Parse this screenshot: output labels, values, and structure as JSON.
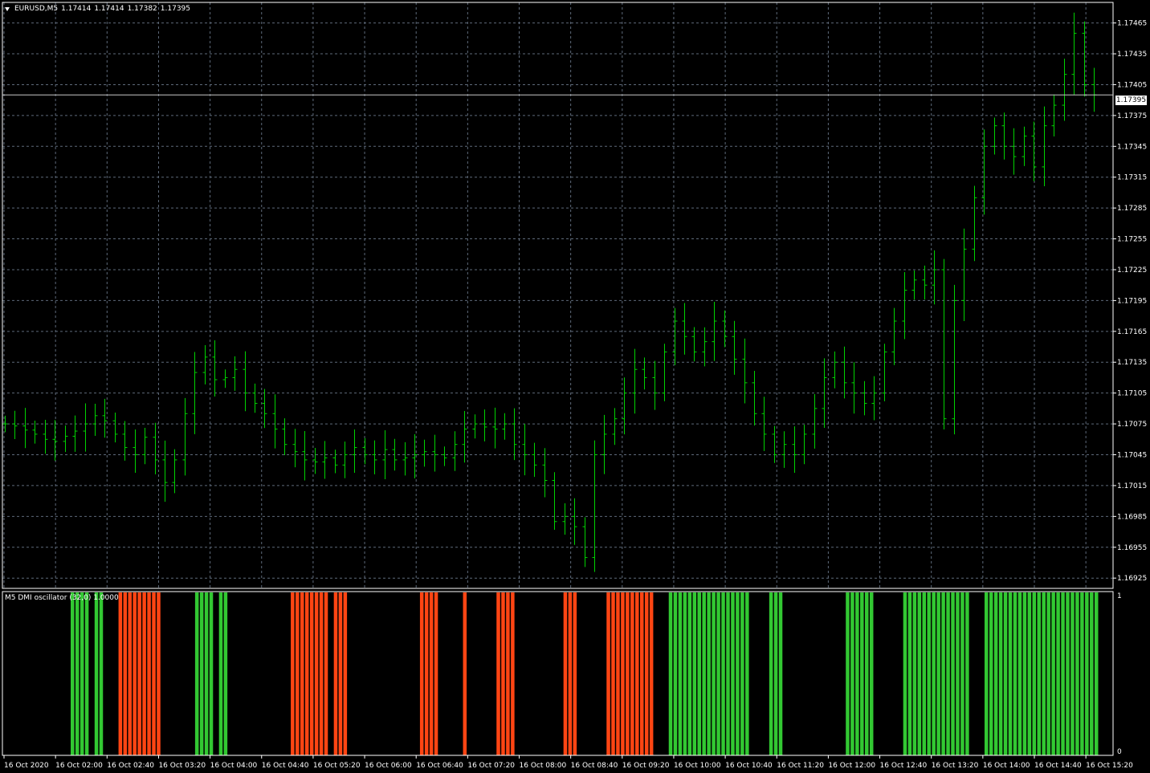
{
  "header": {
    "symbol": "EURUSD,M5",
    "open": "1.17414",
    "high": "1.17414",
    "low": "1.17382",
    "close": "1.17395"
  },
  "current_price": "1.17395",
  "indicator": {
    "label": "M5 DMI oscillator (32,0) 1.0000"
  },
  "colors": {
    "background": "#000000",
    "grid": "#5e6a7a",
    "bar": "#00d200",
    "bull": "#32c832",
    "bear": "#ff4513",
    "axis": "#ffffff"
  },
  "chart_data": [
    {
      "type": "ohlc",
      "title": "",
      "ylim": [
        1.16915,
        1.17485
      ],
      "y_ticks": [
        "1.16925",
        "1.16955",
        "1.16985",
        "1.17015",
        "1.17045",
        "1.17075",
        "1.17105",
        "1.17135",
        "1.17165",
        "1.17195",
        "1.17225",
        "1.17255",
        "1.17285",
        "1.17315",
        "1.17345",
        "1.17375",
        "1.17405",
        "1.17435",
        "1.17465"
      ],
      "x_ticks": [
        "16 Oct 2020",
        "16 Oct 02:00",
        "16 Oct 02:40",
        "16 Oct 03:20",
        "16 Oct 04:00",
        "16 Oct 04:40",
        "16 Oct 05:20",
        "16 Oct 06:00",
        "16 Oct 06:40",
        "16 Oct 07:20",
        "16 Oct 08:00",
        "16 Oct 08:40",
        "16 Oct 09:20",
        "16 Oct 10:00",
        "16 Oct 10:40",
        "16 Oct 11:20",
        "16 Oct 12:00",
        "16 Oct 12:40",
        "16 Oct 13:20",
        "16 Oct 14:00",
        "16 Oct 14:40",
        "16 Oct 15:20"
      ],
      "close_path": [
        1.17075,
        1.17073,
        1.17069,
        1.17065,
        1.1706,
        1.17058,
        1.17063,
        1.17068,
        1.17075,
        1.17083,
        1.17078,
        1.17065,
        1.17052,
        1.17045,
        1.17062,
        1.1704,
        1.17018,
        1.1704,
        1.17085,
        1.17125,
        1.1714,
        1.17118,
        1.1712,
        1.17128,
        1.17105,
        1.17095,
        1.17085,
        1.1707,
        1.17055,
        1.17048,
        1.1704,
        1.17038,
        1.17042,
        1.17035,
        1.17045,
        1.17052,
        1.17045,
        1.1704,
        1.1705,
        1.1704,
        1.17042,
        1.17045,
        1.17048,
        1.17045,
        1.17042,
        1.17055,
        1.1707,
        1.17075,
        1.17072,
        1.1707,
        1.17075,
        1.17055,
        1.17045,
        1.17035,
        1.1702,
        1.1698,
        1.16985,
        1.16975,
        1.16945,
        1.17045,
        1.17065,
        1.1708,
        1.17105,
        1.17128,
        1.1712,
        1.17105,
        1.17145,
        1.17175,
        1.1716,
        1.17145,
        1.17155,
        1.17175,
        1.1716,
        1.17138,
        1.17115,
        1.17085,
        1.17065,
        1.17045,
        1.17055,
        1.17045,
        1.17065,
        1.1709,
        1.1712,
        1.17135,
        1.17115,
        1.17105,
        1.17095,
        1.17105,
        1.17145,
        1.17175,
        1.17205,
        1.17215,
        1.1721,
        1.17225,
        1.1708,
        1.17195,
        1.17245,
        1.17295,
        1.17345,
        1.17365,
        1.17345,
        1.17335,
        1.17355,
        1.17325,
        1.17365,
        1.17385,
        1.17415,
        1.17455,
        1.17405,
        1.17395
      ]
    },
    {
      "type": "histogram",
      "title": "M5 DMI oscillator (32,0) 1.0000",
      "ylim": [
        0,
        1
      ],
      "y_ticks": [
        "1",
        "0"
      ],
      "groups": [
        {
          "sign": 1,
          "count": 4
        },
        {
          "sign": 0,
          "count": 1
        },
        {
          "sign": 1,
          "count": 2
        },
        {
          "sign": 0,
          "count": 3
        },
        {
          "sign": -1,
          "count": 9
        },
        {
          "sign": 0,
          "count": 7
        },
        {
          "sign": 1,
          "count": 4
        },
        {
          "sign": 0,
          "count": 1
        },
        {
          "sign": 1,
          "count": 2
        },
        {
          "sign": 0,
          "count": 13
        },
        {
          "sign": -1,
          "count": 8
        },
        {
          "sign": 0,
          "count": 1
        },
        {
          "sign": -1,
          "count": 3
        },
        {
          "sign": 0,
          "count": 15
        },
        {
          "sign": -1,
          "count": 4
        },
        {
          "sign": 0,
          "count": 5
        },
        {
          "sign": -1,
          "count": 1
        },
        {
          "sign": 0,
          "count": 6
        },
        {
          "sign": -1,
          "count": 4
        },
        {
          "sign": 0,
          "count": 10
        },
        {
          "sign": -1,
          "count": 3
        },
        {
          "sign": 0,
          "count": 6
        },
        {
          "sign": -1,
          "count": 10
        },
        {
          "sign": 0,
          "count": 3
        },
        {
          "sign": 1,
          "count": 17
        },
        {
          "sign": 0,
          "count": 4
        },
        {
          "sign": 1,
          "count": 3
        },
        {
          "sign": 0,
          "count": 13
        },
        {
          "sign": 1,
          "count": 6
        },
        {
          "sign": 0,
          "count": 6
        },
        {
          "sign": 1,
          "count": 14
        },
        {
          "sign": 0,
          "count": 3
        },
        {
          "sign": 1,
          "count": 24
        }
      ]
    }
  ]
}
